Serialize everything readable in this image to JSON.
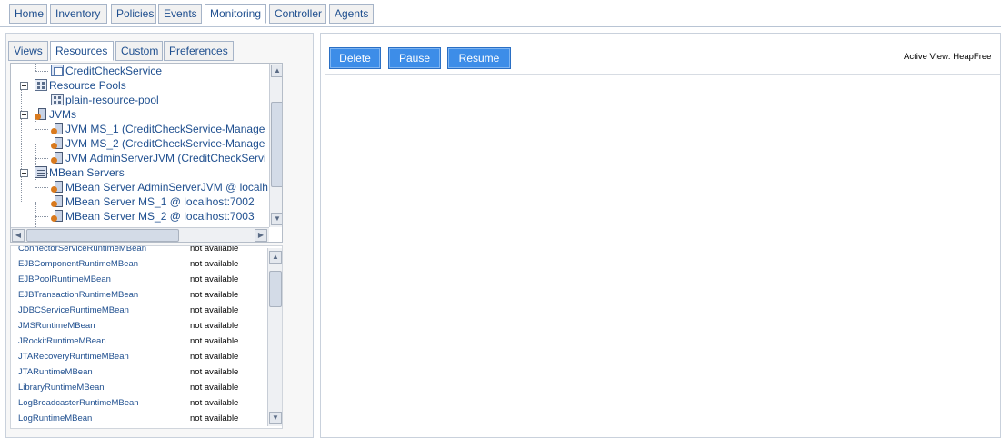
{
  "top_tabs": [
    {
      "label": "Home",
      "active": false
    },
    {
      "label": "Inventory",
      "active": false
    },
    {
      "label": "Policies",
      "active": false
    },
    {
      "label": "Events",
      "active": false
    },
    {
      "label": "Monitoring",
      "active": true
    },
    {
      "label": "Controller",
      "active": false
    },
    {
      "label": "Agents",
      "active": false
    }
  ],
  "left_tabs": [
    {
      "label": "Views",
      "active": false
    },
    {
      "label": "Resources",
      "active": true
    },
    {
      "label": "Custom",
      "active": false
    },
    {
      "label": "Preferences",
      "active": false
    }
  ],
  "tree": {
    "items": [
      {
        "label": "CreditCheckService",
        "icon": "service-icon"
      },
      {
        "label": "Resource Pools",
        "icon": "resource-pool-icon"
      },
      {
        "label": "plain-resource-pool",
        "icon": "resource-pool-icon"
      },
      {
        "label": "JVMs",
        "icon": "jvm-icon"
      },
      {
        "label": "JVM MS_1 (CreditCheckService-Manage",
        "icon": "jvm-icon"
      },
      {
        "label": "JVM MS_2 (CreditCheckService-Manage",
        "icon": "jvm-icon"
      },
      {
        "label": "JVM AdminServerJVM (CreditCheckServi",
        "icon": "jvm-icon"
      },
      {
        "label": "MBean Servers",
        "icon": "mbean-servers-icon"
      },
      {
        "label": "MBean Server AdminServerJVM @ localh",
        "icon": "mbean-server-icon"
      },
      {
        "label": "MBean Server MS_1 @ localhost:7002",
        "icon": "mbean-server-icon"
      },
      {
        "label": "MBean Server MS_2 @ localhost:7003",
        "icon": "mbean-server-icon"
      }
    ]
  },
  "metrics": {
    "partial_top": {
      "name": "ConnectorServiceRuntimeMBean",
      "status": "not available"
    },
    "rows": [
      {
        "name": "EJBComponentRuntimeMBean",
        "status": "not available"
      },
      {
        "name": "EJBPoolRuntimeMBean",
        "status": "not available"
      },
      {
        "name": "EJBTransactionRuntimeMBean",
        "status": "not available"
      },
      {
        "name": "JDBCServiceRuntimeMBean",
        "status": "not available"
      },
      {
        "name": "JMSRuntimeMBean",
        "status": "not available"
      },
      {
        "name": "JRockitRuntimeMBean",
        "status": "not available"
      },
      {
        "name": "JTARecoveryRuntimeMBean",
        "status": "not available"
      },
      {
        "name": "JTARuntimeMBean",
        "status": "not available"
      },
      {
        "name": "LibraryRuntimeMBean",
        "status": "not available"
      },
      {
        "name": "LogBroadcasterRuntimeMBean",
        "status": "not available"
      },
      {
        "name": "LogRuntimeMBean",
        "status": "not available"
      }
    ]
  },
  "actions": {
    "delete": "Delete",
    "pause": "Pause",
    "resume": "Resume"
  },
  "active_view": "Active View: HeapFree",
  "colors": {
    "link": "#1f4f8f",
    "button_bg": "#3d8de8",
    "tab_border": "#a6b4c8"
  }
}
